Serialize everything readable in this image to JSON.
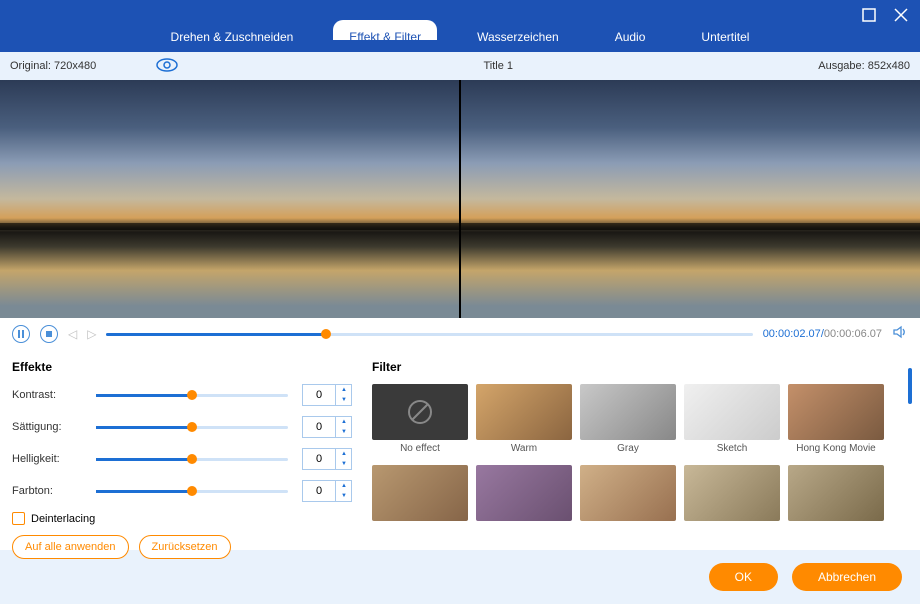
{
  "tabs": {
    "rotate": "Drehen & Zuschneiden",
    "effect": "Effekt & Filter",
    "watermark": "Wasserzeichen",
    "audio": "Audio",
    "subtitle": "Untertitel"
  },
  "infobar": {
    "original_label": "Original:",
    "original_res": "720x480",
    "title": "Title 1",
    "output_label": "Ausgabe:",
    "output_res": "852x480"
  },
  "playback": {
    "current": "00:00:02.07",
    "total": "00:00:06.07",
    "progress_percent": 34
  },
  "effects": {
    "section": "Effekte",
    "contrast_label": "Kontrast:",
    "saturation_label": "Sättigung:",
    "brightness_label": "Helligkeit:",
    "hue_label": "Farbton:",
    "contrast": "0",
    "saturation": "0",
    "brightness": "0",
    "hue": "0",
    "deinterlacing": "Deinterlacing",
    "apply_all": "Auf alle anwenden",
    "reset": "Zurücksetzen"
  },
  "filters": {
    "section": "Filter",
    "items": [
      {
        "label": "No effect"
      },
      {
        "label": "Warm"
      },
      {
        "label": "Gray"
      },
      {
        "label": "Sketch"
      },
      {
        "label": "Hong Kong Movie"
      }
    ]
  },
  "footer": {
    "ok": "OK",
    "cancel": "Abbrechen"
  }
}
